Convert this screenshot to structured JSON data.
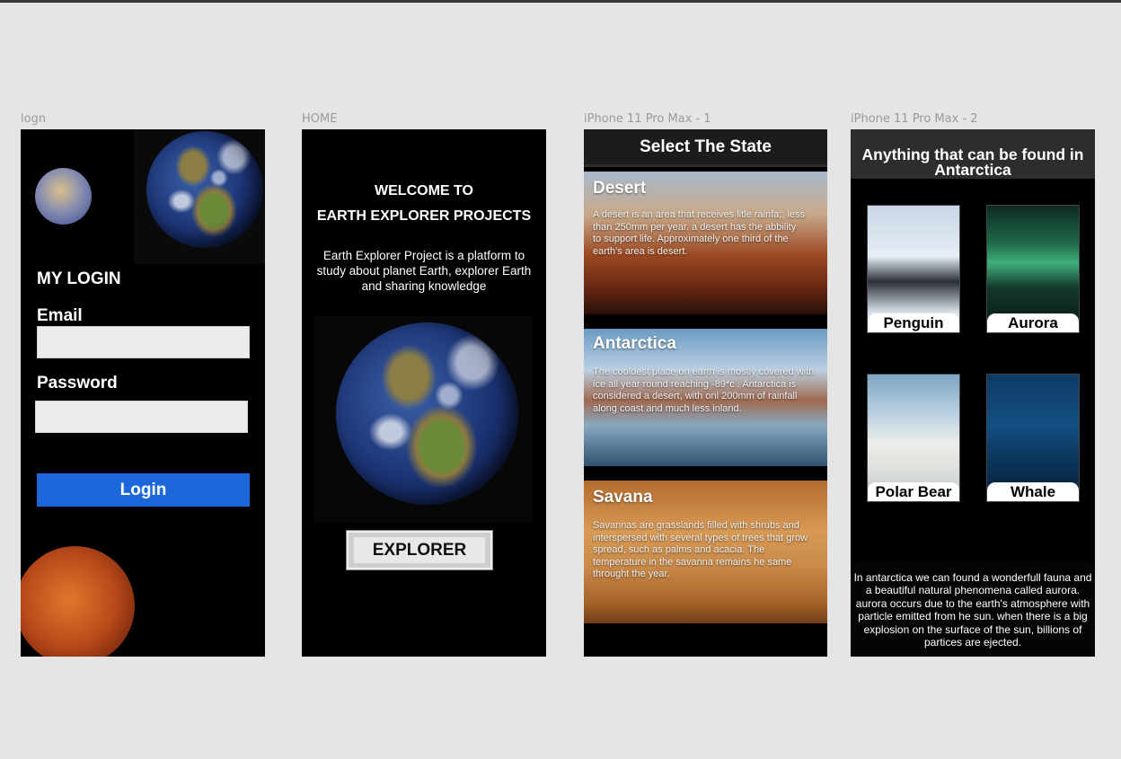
{
  "frames": {
    "login": {
      "label": "logn"
    },
    "home": {
      "label": "HOME"
    },
    "states": {
      "label": "iPhone 11 Pro Max - 1"
    },
    "antarctica": {
      "label": "iPhone 11 Pro Max - 2"
    }
  },
  "login": {
    "heading": "MY LOGIN",
    "email_label": "Email",
    "email_value": "",
    "password_label": "Password",
    "password_value": "",
    "login_button": "Login"
  },
  "home": {
    "welcome_line1": "WELCOME TO",
    "welcome_line2": "EARTH EXPLORER PROJECTS",
    "description": "Earth Explorer Project is a platform to study about planet Earth, explorer Earth and sharing knowledge",
    "explorer_button": "EXPLORER"
  },
  "states": {
    "header": "Select The State",
    "items": [
      {
        "title": "Desert",
        "text": "A desert is an area that receives litle rainfa;; less than 250mm per year. a desert has the abbility to support life. Approximately one third of the earth's area is desert."
      },
      {
        "title": "Antarctica",
        "text": "The cooldest place on earth is mostly covered with ice all year round reaching -89*c . Antarctica is considered a desert, with onl 200mm of rainfall along coast and much less inland."
      },
      {
        "title": "Savana",
        "text": "Savannas are grasslands filled with shrubs and interspersed with several types of trees that grow spread, such as palms and acacia. The temperature in the savanna remains he same throught the year."
      }
    ]
  },
  "antarctica": {
    "header": "Anything that can be found in Antarctica",
    "tiles": [
      {
        "label": "Penguin"
      },
      {
        "label": "Aurora"
      },
      {
        "label": "Polar Bear"
      },
      {
        "label": "Whale"
      }
    ],
    "info": "In antarctica we can found a wonderfull fauna and a beautiful natural phenomena called aurora. aurora occurs due to the earth's atmosphere with particle emitted from he sun. when there is a big explosion on the surface of the sun, billions of partices are ejected."
  }
}
